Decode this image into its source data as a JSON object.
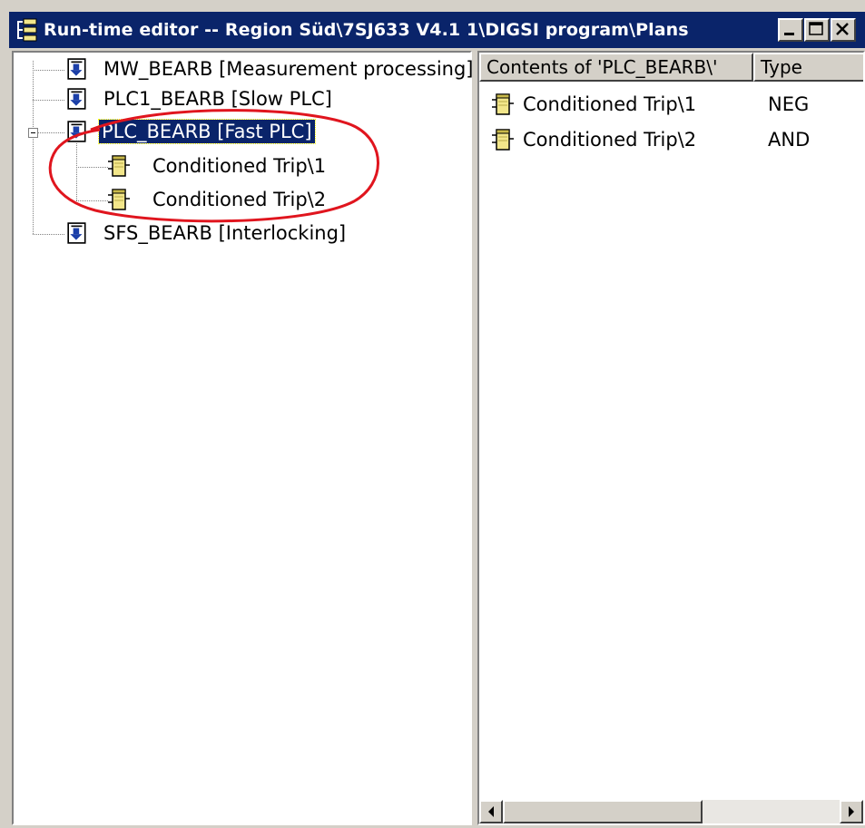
{
  "window": {
    "title": "Run-time editor -- Region Süd\\7SJ633 V4.1 1\\DIGSI program\\Plans",
    "title_icon": "tree-structure-icon",
    "colors": {
      "titlebar": "#0a246a",
      "selection": "#0a246a",
      "annotation": "#e0151e"
    }
  },
  "tree": {
    "items": [
      {
        "label": "MW_BEARB  [Measurement processing]",
        "icon": "plan-icon"
      },
      {
        "label": "PLC1_BEARB  [Slow PLC]",
        "icon": "plan-icon"
      },
      {
        "label": "PLC_BEARB  [Fast PLC]",
        "icon": "plan-icon",
        "selected": true,
        "expanded": true,
        "children": [
          {
            "label": "Conditioned Trip\\1",
            "icon": "function-block-icon"
          },
          {
            "label": "Conditioned Trip\\2",
            "icon": "function-block-icon"
          }
        ]
      },
      {
        "label": "SFS_BEARB  [Interlocking]",
        "icon": "plan-icon"
      }
    ]
  },
  "list": {
    "columns": [
      "Contents of 'PLC_BEARB\\'",
      "Type"
    ],
    "rows": [
      {
        "name": "Conditioned Trip\\1",
        "type": "NEG"
      },
      {
        "name": "Conditioned Trip\\2",
        "type": "AND"
      }
    ]
  }
}
